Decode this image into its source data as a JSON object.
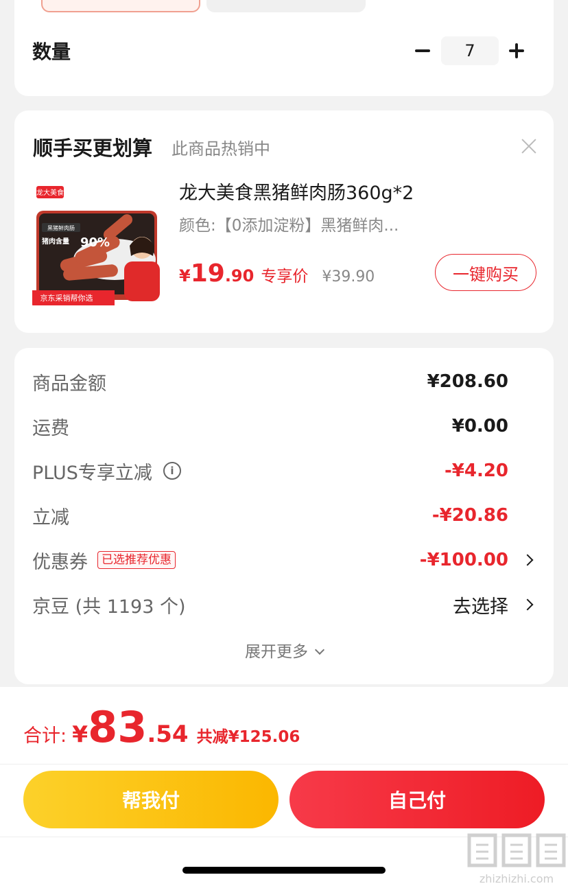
{
  "quantity": {
    "label": "数量",
    "value": "7"
  },
  "recommend": {
    "title": "顺手买更划算",
    "subtitle": "此商品热销中",
    "product": {
      "name": "龙大美食黑猪鲜肉肠360g*2",
      "spec": "颜色:【0添加淀粉】黑猪鲜肉...",
      "price_currency": "¥",
      "price_int": "19",
      "price_dec": ".90",
      "price_tag": "专享价",
      "price_old": "¥39.90",
      "buy_label": "一键购买",
      "image_brand": "龙大美食",
      "image_badge": "黑猪鲜肉肠",
      "image_pct_label": "猪肉含量",
      "image_pct": "90%",
      "image_footer": "京东采销帮你选"
    }
  },
  "summary": {
    "rows": [
      {
        "label": "商品金额",
        "value": "¥208.60"
      },
      {
        "label": "运费",
        "value": "¥0.00"
      },
      {
        "label": "PLUS专享立减",
        "value": "-¥4.20"
      },
      {
        "label": "立减",
        "value": "-¥20.86"
      },
      {
        "label": "优惠券",
        "badge": "已选推荐优惠",
        "value": "-¥100.00"
      },
      {
        "label": "京豆 (共 1193 个)",
        "value": "去选择"
      }
    ],
    "expand_label": "展开更多"
  },
  "footer": {
    "total_label": "合计:",
    "total_currency": "¥",
    "total_int": "83",
    "total_dec": ".54",
    "total_off": "共减¥125.06",
    "help_pay": "帮我付",
    "self_pay": "自己付",
    "watermark": "zhizhizhi.com"
  },
  "colors": {
    "accent_red": "#e8262d",
    "help_yellow": "#fcc419",
    "self_red": "#f5222d"
  }
}
